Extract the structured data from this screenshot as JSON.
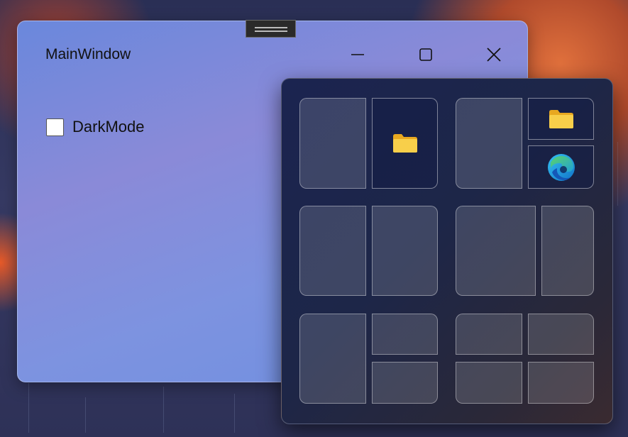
{
  "window": {
    "title": "MainWindow",
    "controls": [
      "minimize",
      "maximize",
      "close"
    ]
  },
  "settings": {
    "darkmode_label": "DarkMode",
    "darkmode_checked": false
  },
  "snap_flyout": {
    "layouts": [
      {
        "name": "two-columns",
        "zones": [
          "empty",
          "file-explorer"
        ]
      },
      {
        "name": "main-with-two-stacked",
        "zones": [
          "empty",
          "file-explorer",
          "edge"
        ]
      },
      {
        "name": "two-columns-equal",
        "zones": [
          "empty",
          "empty"
        ]
      },
      {
        "name": "wide-and-narrow",
        "zones": [
          "empty",
          "empty"
        ]
      },
      {
        "name": "column-with-two-stacked",
        "zones": [
          "empty",
          "empty",
          "empty"
        ]
      },
      {
        "name": "quad-grid",
        "zones": [
          "empty",
          "empty",
          "empty",
          "empty"
        ]
      }
    ]
  },
  "icons": {
    "folder": "folder-icon",
    "edge": "edge-browser-icon",
    "minimize": "minimize-icon",
    "maximize": "maximize-icon",
    "close": "close-icon"
  },
  "colors": {
    "window_accent": "#7a8ee0",
    "flyout_bg": "#1d2648",
    "folder_yellow": "#f5c842"
  }
}
